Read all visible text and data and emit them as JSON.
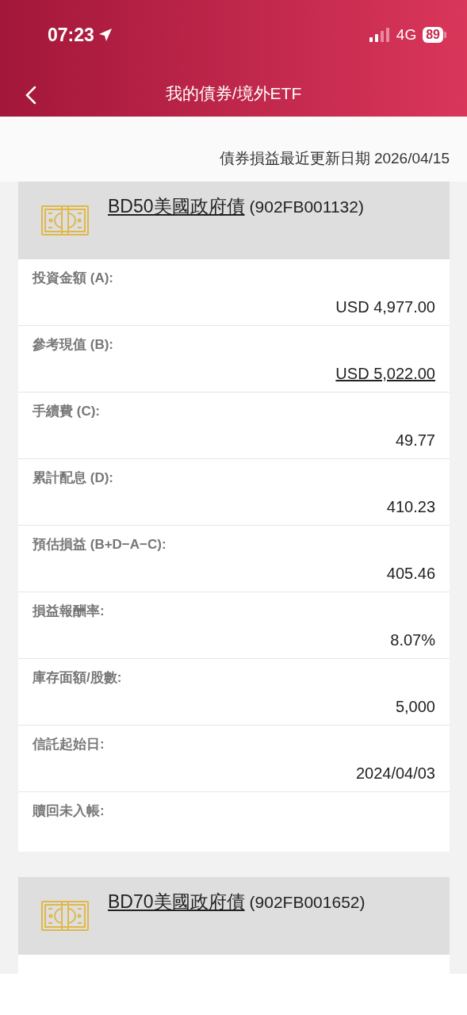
{
  "status_bar": {
    "time": "07:23",
    "network": "4G",
    "battery": "89"
  },
  "nav": {
    "title": "我的債券/境外ETF"
  },
  "update_note": "債券損益最近更新日期 2026/04/15",
  "bonds": [
    {
      "name": "BD50美國政府債",
      "code": "(902FB001132)",
      "rows": [
        {
          "label": "投資金額 (A):",
          "value": "USD 4,977.00"
        },
        {
          "label": "參考現值 (B):",
          "value": "USD 5,022.00",
          "linked": true
        },
        {
          "label": "手續費 (C):",
          "value": "49.77"
        },
        {
          "label": "累計配息 (D):",
          "value": "410.23"
        },
        {
          "label": "預估損益 (B+D−A−C):",
          "value": "405.46"
        },
        {
          "label": "損益報酬率:",
          "value": "8.07%"
        },
        {
          "label": "庫存面額/股數:",
          "value": "5,000"
        },
        {
          "label": "信託起始日:",
          "value": "2024/04/03"
        },
        {
          "label": "贖回未入帳:"
        }
      ]
    },
    {
      "name": "BD70美國政府債",
      "code": "(902FB001652)"
    }
  ]
}
